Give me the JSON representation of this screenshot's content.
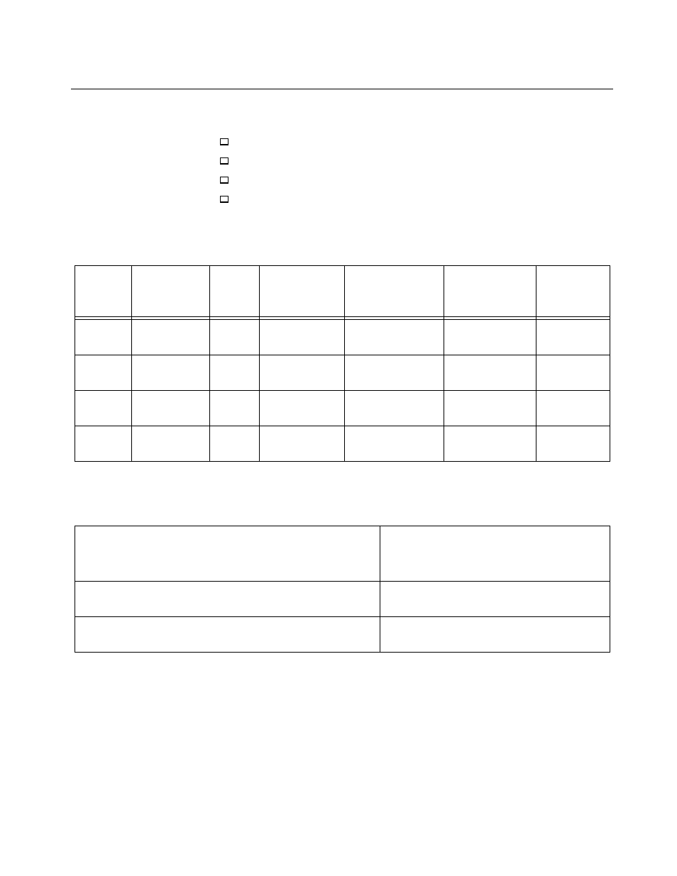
{
  "bullets": [
    {
      "label": ""
    },
    {
      "label": ""
    },
    {
      "label": ""
    },
    {
      "label": ""
    }
  ],
  "table1": {
    "columns": 7,
    "rows": 4
  },
  "table2": {
    "columns": 2,
    "rows": 2
  }
}
